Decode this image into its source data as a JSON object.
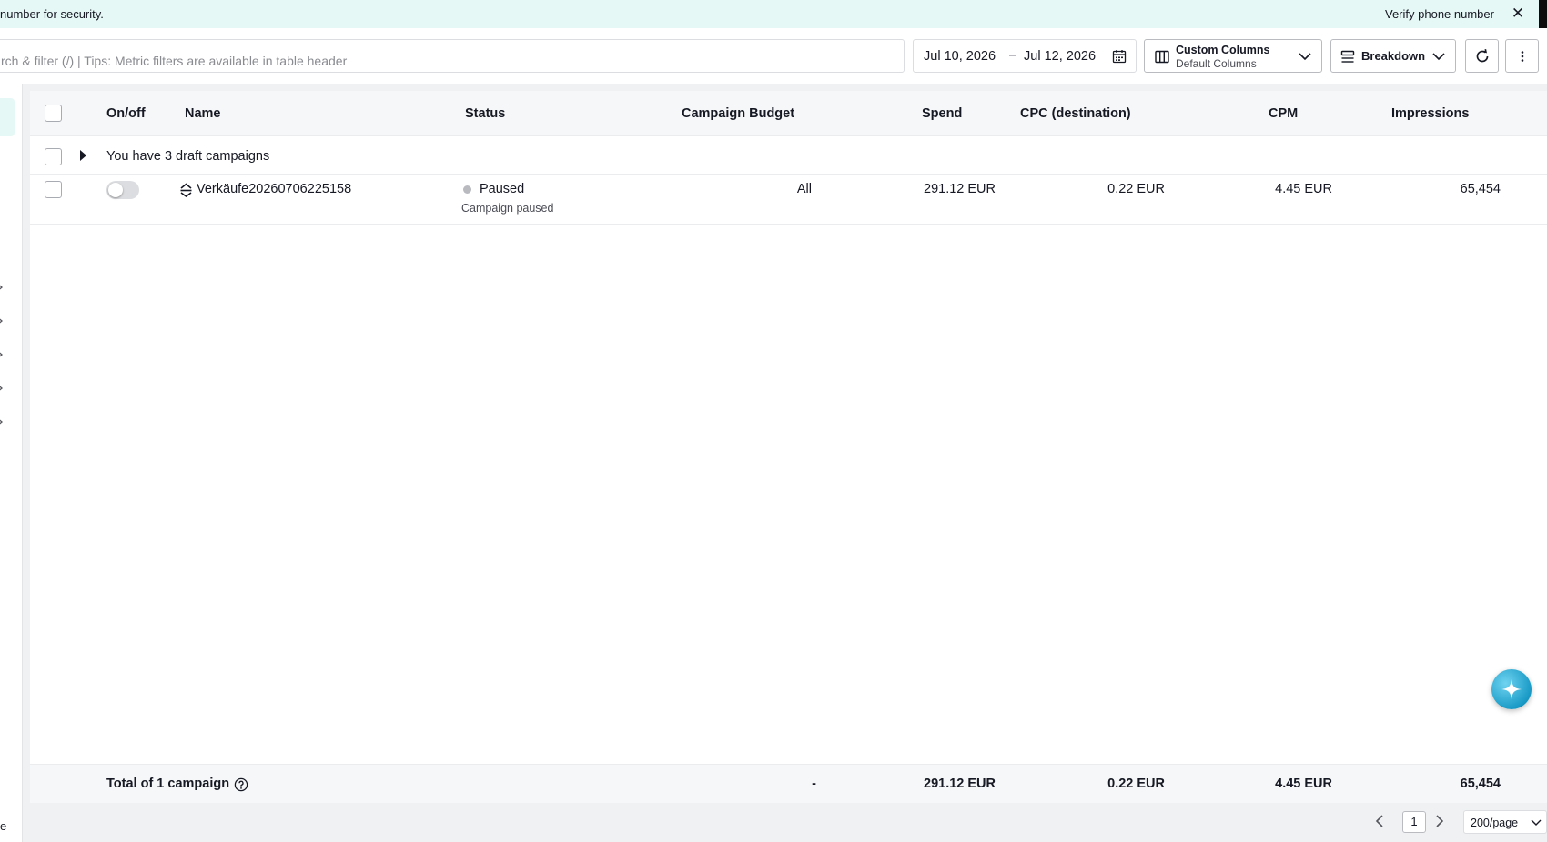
{
  "banner": {
    "message": "number for security.",
    "verify_label": "Verify phone number",
    "close_glyph": "✕"
  },
  "toolbar": {
    "search_placeholder": "rch & filter (/) | Tips: Metric filters are available in table header",
    "date_start": "Jul 10, 2026",
    "date_separator": "–",
    "date_end": "Jul 12, 2026",
    "columns_title": "Custom Columns",
    "columns_value": "Default Columns",
    "breakdown_label": "Breakdown"
  },
  "table": {
    "headers": {
      "onoff": "On/off",
      "name": "Name",
      "status": "Status",
      "budget": "Campaign Budget",
      "spend": "Spend",
      "cpc": "CPC (destination)",
      "cpm": "CPM",
      "impressions": "Impressions"
    },
    "draft_text": "You have 3 draft campaigns",
    "rows": [
      {
        "toggle_on": false,
        "name": "Verkäufe20260706225158",
        "status": "Paused",
        "status_sub": "Campaign paused",
        "budget": "All",
        "spend": "291.12 EUR",
        "cpc": "0.22 EUR",
        "cpm": "4.45 EUR",
        "impressions": "65,454"
      }
    ],
    "footer": {
      "label": "Total of 1 campaign",
      "budget": "-",
      "spend": "291.12 EUR",
      "cpc": "0.22 EUR",
      "cpm": "4.45 EUR",
      "impressions": "65,454"
    }
  },
  "pagination": {
    "current_page": "1",
    "page_size": "200/page"
  },
  "sidebar": {
    "bottom_fragment": "e"
  },
  "colors": {
    "banner_bg": "#e6f8f6",
    "assistant": "#1a9bc7"
  }
}
